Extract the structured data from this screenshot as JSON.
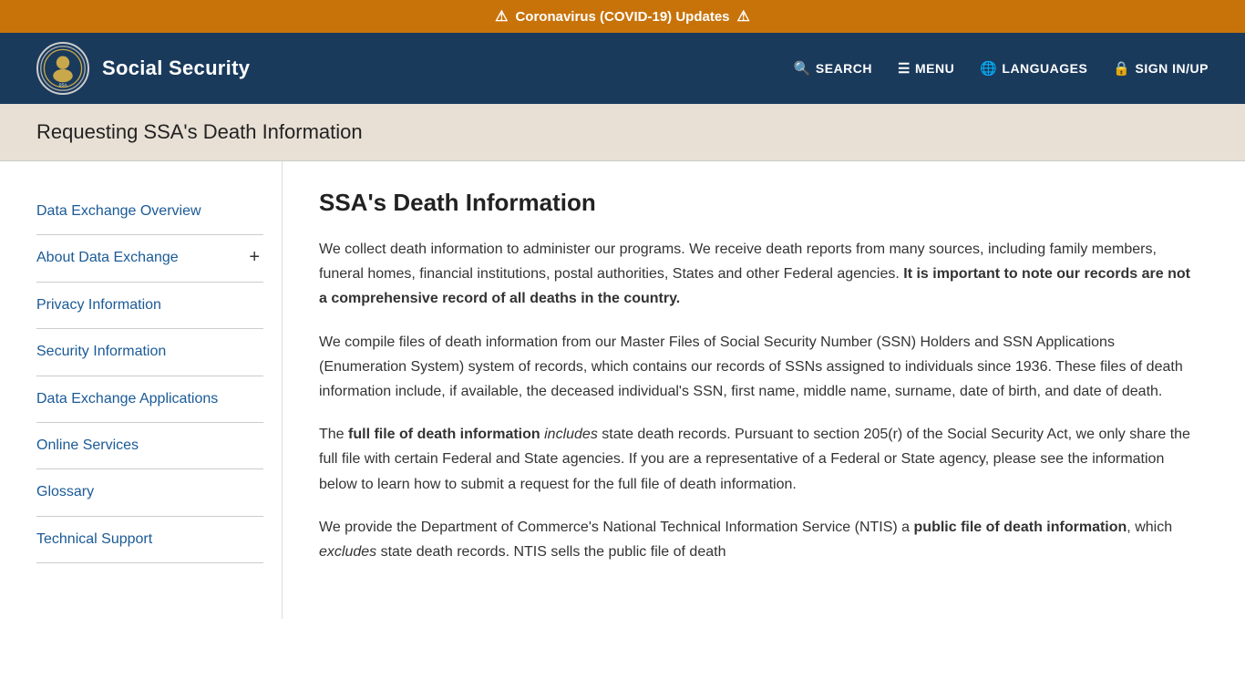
{
  "alert": {
    "text": "Coronavirus (COVID-19) Updates",
    "icon": "⚠"
  },
  "header": {
    "site_title": "Social Security",
    "nav": [
      {
        "label": "SEARCH",
        "icon": "🔍",
        "id": "search"
      },
      {
        "label": "MENU",
        "icon": "☰",
        "id": "menu"
      },
      {
        "label": "LANGUAGES",
        "icon": "🌐",
        "id": "languages"
      },
      {
        "label": "SIGN IN/UP",
        "icon": "🔒",
        "id": "signin"
      }
    ]
  },
  "page_title": "Requesting SSA's Death Information",
  "sidebar": {
    "items": [
      {
        "label": "Data Exchange Overview",
        "id": "data-exchange-overview",
        "has_expand": false
      },
      {
        "label": "About Data Exchange",
        "id": "about-data-exchange",
        "has_expand": true
      },
      {
        "label": "Privacy Information",
        "id": "privacy-information",
        "has_expand": false
      },
      {
        "label": "Security Information",
        "id": "security-information",
        "has_expand": false
      },
      {
        "label": "Data Exchange Applications",
        "id": "data-exchange-applications",
        "has_expand": false
      },
      {
        "label": "Online Services",
        "id": "online-services",
        "has_expand": false
      },
      {
        "label": "Glossary",
        "id": "glossary",
        "has_expand": false
      },
      {
        "label": "Technical Support",
        "id": "technical-support",
        "has_expand": false
      }
    ]
  },
  "main": {
    "heading": "SSA's Death Information",
    "paragraphs": [
      {
        "id": "p1",
        "text_parts": [
          {
            "type": "normal",
            "text": "We collect death information to administer our programs.  We receive death reports from many sources, including family members, funeral homes, financial institutions, postal authorities, States and other Federal agencies.  "
          },
          {
            "type": "bold",
            "text": "It is important to note our records are not a comprehensive record of all deaths in the country."
          }
        ]
      },
      {
        "id": "p2",
        "text_parts": [
          {
            "type": "normal",
            "text": "We compile files of death information from our Master Files of Social Security Number (SSN) Holders and SSN Applications (Enumeration System) system of records, which contains our records of SSNs assigned to individuals since 1936.  These files of death information include, if available, the deceased individual's SSN, first name, middle name, surname, date of birth, and date of death."
          }
        ]
      },
      {
        "id": "p3",
        "text_parts": [
          {
            "type": "normal",
            "text": "The "
          },
          {
            "type": "bold",
            "text": "full file of death information"
          },
          {
            "type": "normal",
            "text": " "
          },
          {
            "type": "italic",
            "text": "includes"
          },
          {
            "type": "normal",
            "text": " state death records.  Pursuant to section 205(r) of the Social Security Act, we only share the full file with certain Federal and State agencies.  If you are a representative of a Federal or State agency, please see the information below to learn how to submit a request for the full file of death information."
          }
        ]
      },
      {
        "id": "p4",
        "text_parts": [
          {
            "type": "normal",
            "text": "We provide the Department of Commerce's National Technical Information Service (NTIS) a "
          },
          {
            "type": "bold",
            "text": "public file of death information"
          },
          {
            "type": "normal",
            "text": ", which "
          },
          {
            "type": "italic",
            "text": "excludes"
          },
          {
            "type": "normal",
            "text": " state death records.  NTIS sells the public file of death"
          }
        ]
      }
    ]
  }
}
